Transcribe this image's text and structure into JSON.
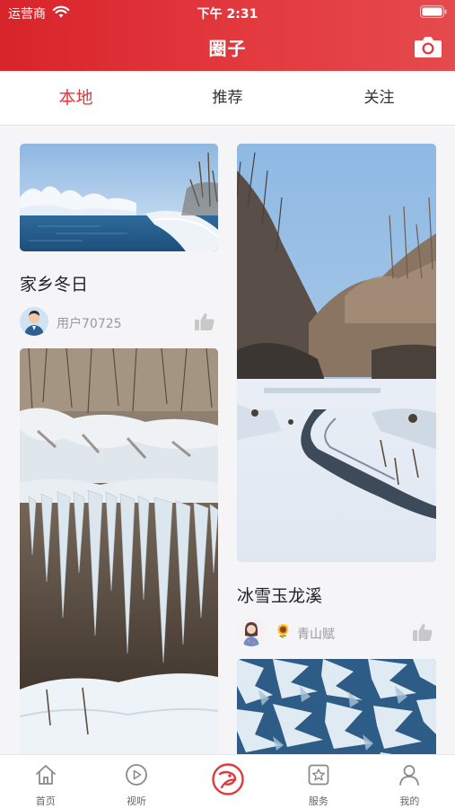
{
  "status_bar": {
    "carrier": "运营商",
    "time": "下午 2:31"
  },
  "header": {
    "title": "圈子"
  },
  "tabs": [
    {
      "label": "本地",
      "active": true
    },
    {
      "label": "推荐",
      "active": false
    },
    {
      "label": "关注",
      "active": false
    }
  ],
  "posts": [
    {
      "title": "家乡冬日",
      "user": "用户70725"
    },
    {
      "title": "冰雪玉龙溪",
      "user_badge": "🌻",
      "user": "青山赋"
    }
  ],
  "bottom_nav": [
    {
      "label": "首页",
      "icon": "home-icon"
    },
    {
      "label": "视听",
      "icon": "play-circle-icon"
    },
    {
      "label": "",
      "icon": "center-logo-icon"
    },
    {
      "label": "服务",
      "icon": "star-box-icon"
    },
    {
      "label": "我的",
      "icon": "person-icon"
    }
  ],
  "colors": {
    "brand": "#e0383d",
    "header_gradient_start": "#d8242b",
    "header_gradient_end": "#e54a4d"
  }
}
